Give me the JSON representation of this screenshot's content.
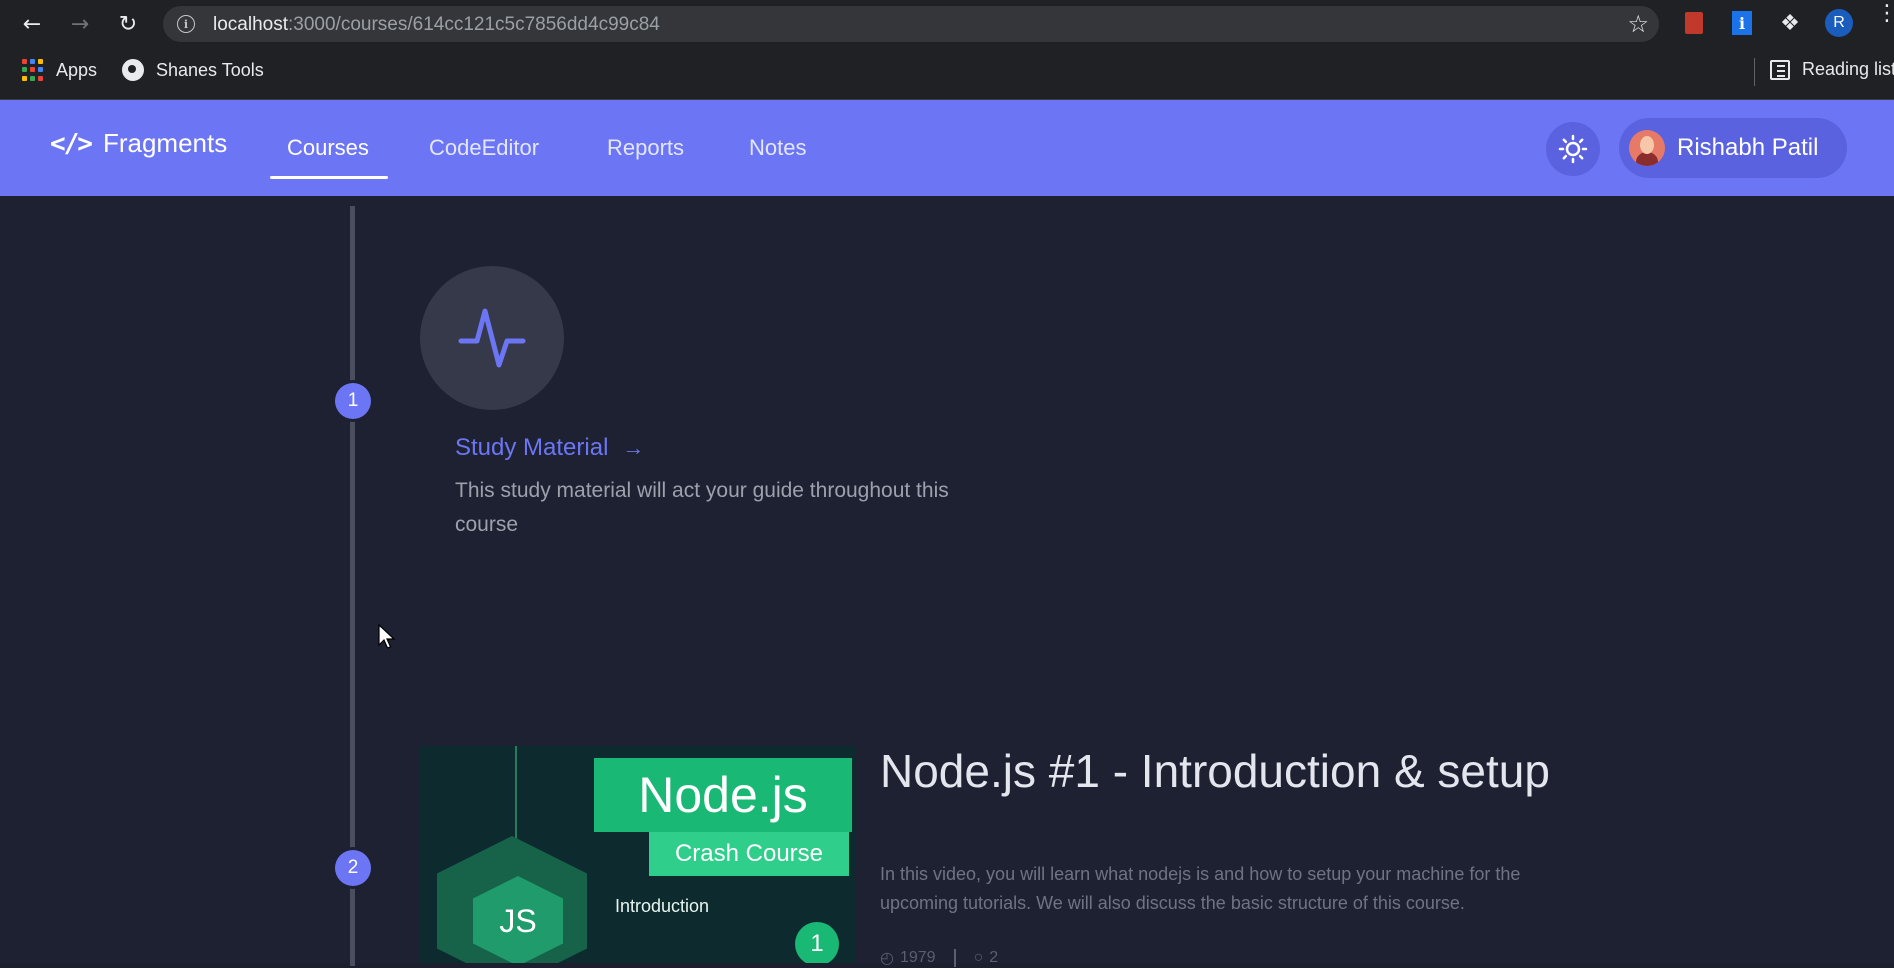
{
  "browser": {
    "url_host": "localhost",
    "url_path": ":3000/courses/614cc121c5c7856dd4c99c84",
    "profile_initial": "R",
    "bookmarks": [
      {
        "label": "Apps",
        "icon": "apps-grid-icon"
      },
      {
        "label": "Shanes Tools",
        "icon": "globe-icon"
      }
    ],
    "reading_list_label": "Reading list"
  },
  "navbar": {
    "brand_icon": "</>",
    "brand_name": "Fragments",
    "links": [
      {
        "label": "Courses",
        "active": true
      },
      {
        "label": "CodeEditor",
        "active": false
      },
      {
        "label": "Reports",
        "active": false
      },
      {
        "label": "Notes",
        "active": false
      }
    ],
    "theme_icon": "sun-icon",
    "user_name": "Rishabh Patil",
    "accent": "#6c76f4"
  },
  "timeline": {
    "steps": [
      {
        "number": "1",
        "icon": "activity-icon",
        "title": "Study Material",
        "description": "This study material will act your guide throughout this course"
      },
      {
        "number": "2",
        "thumbnail": {
          "logo": "Node.js",
          "subtitle": "Crash Course",
          "badge": "JS",
          "label": "Introduction",
          "episode": "1"
        },
        "title": "Node.js #1 - Introduction & setup",
        "description": "In this video, you will learn what nodejs is and how to setup your machine for the upcoming tutorials. We will also discuss the basic structure of this course.",
        "views": "1979",
        "comments": "2"
      }
    ]
  }
}
